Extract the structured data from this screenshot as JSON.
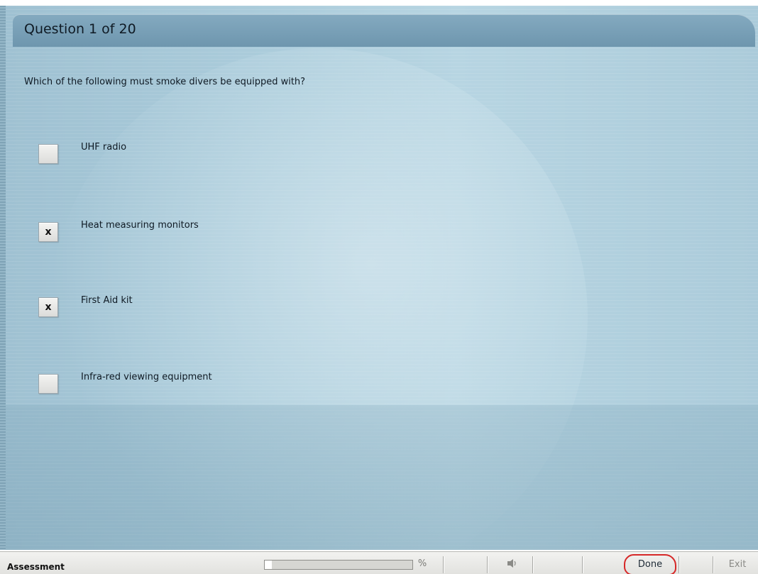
{
  "header": {
    "title": "Question 1 of 20"
  },
  "question": {
    "text": "Which of the following must smoke divers be equipped with?"
  },
  "options": [
    {
      "label": "UHF radio",
      "mark": ""
    },
    {
      "label": "Heat measuring monitors",
      "mark": "x"
    },
    {
      "label": "First Aid kit",
      "mark": "x"
    },
    {
      "label": "Infra-red viewing equipment",
      "mark": ""
    }
  ],
  "taskbar": {
    "section_label": "Assessment",
    "progress_fraction": 0.05,
    "percent_icon": "percent-icon",
    "audio_icon": "speaker-icon",
    "done_label": "Done",
    "exit_label": "Exit"
  },
  "colors": {
    "panel": "#abccdb",
    "header": "#7aa1b8",
    "done_highlight": "#d62828"
  }
}
